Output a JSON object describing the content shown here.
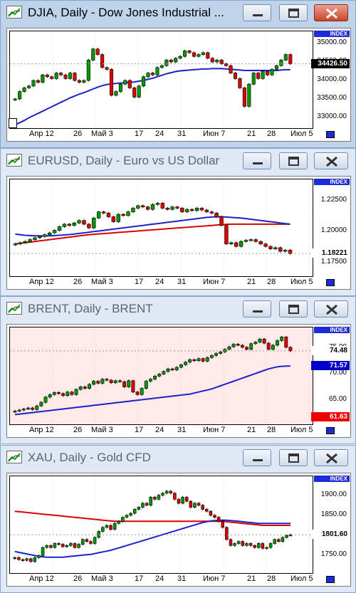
{
  "windows": [
    {
      "title": "DJIA, Daily - Dow Jones Industrial ...",
      "active": true,
      "index_label": "INDEX",
      "background": "#ffffff",
      "y_ticks": [
        "35000.00",
        "34500.00",
        "34000.00",
        "33500.00",
        "33000.00"
      ],
      "price_box": {
        "label": "34426.50",
        "bg": "#000000",
        "fg": "#ffffff"
      },
      "extra_boxes": [],
      "x_labels": [
        "Апр 12",
        "26",
        "Май 3",
        "17",
        "24",
        "31",
        "Июн 7",
        "21",
        "28",
        "Июл 5"
      ]
    },
    {
      "title": "EURUSD, Daily - Euro vs US Dollar",
      "active": false,
      "index_label": "INDEX",
      "background": "#ffffff",
      "y_ticks": [
        "1.22500",
        "1.20000",
        "1.17500"
      ],
      "price_box": {
        "label": "1.18221",
        "bg": "#ffffff",
        "fg": "#000000"
      },
      "extra_boxes": [],
      "x_labels": [
        "Апр 12",
        "26",
        "Май 3",
        "17",
        "24",
        "31",
        "Июн 7",
        "21",
        "28",
        "Июл 5"
      ]
    },
    {
      "title": "BRENT, Daily - BRENT",
      "active": false,
      "index_label": "INDEX",
      "background": "#ffe9e9",
      "y_ticks": [
        "75.00",
        "70.00",
        "65.00"
      ],
      "price_box": {
        "label": "74.48",
        "bg": "#ffffff",
        "fg": "#000000"
      },
      "extra_boxes": [
        {
          "label": "71.57",
          "bg": "#0000cc",
          "fg": "#ffffff"
        },
        {
          "label": "61.63",
          "bg": "#ee0000",
          "fg": "#ffffff"
        }
      ],
      "x_labels": [
        "Апр 12",
        "26",
        "Май 3",
        "17",
        "24",
        "31",
        "Июн 7",
        "21",
        "28",
        "Июл 5"
      ]
    },
    {
      "title": "XAU, Daily - Gold CFD",
      "active": false,
      "index_label": "INDEX",
      "background": "#ffffff",
      "y_ticks": [
        "1900.00",
        "1850.00",
        "1800.00",
        "1750.00"
      ],
      "price_box": {
        "label": "1801.60",
        "bg": "#ffffff",
        "fg": "#000000"
      },
      "extra_boxes": [],
      "x_labels": [
        "Апр 12",
        "26",
        "Май 3",
        "17",
        "24",
        "31",
        "Июн 7",
        "21",
        "28",
        "Июл 5"
      ]
    }
  ],
  "colors": {
    "bull": "#009900",
    "bear": "#dd0000",
    "ma_fast": "#1d22c9",
    "ma_slow": "#dd0000"
  },
  "chart_data": [
    {
      "type": "candlestick",
      "symbol": "DJIA",
      "ylim": [
        32750,
        35250
      ],
      "close": [
        33500,
        33700,
        33800,
        33850,
        34000,
        33950,
        34150,
        34100,
        34050,
        34200,
        34150,
        34050,
        34200,
        34000,
        33950,
        34000,
        34550,
        34850,
        34700,
        34350,
        34300,
        33600,
        33700,
        33900,
        34000,
        33800,
        33550,
        33850,
        34100,
        34200,
        34150,
        34350,
        34400,
        34550,
        34500,
        34600,
        34650,
        34800,
        34750,
        34650,
        34700,
        34750,
        34600,
        34500,
        34550,
        34450,
        34400,
        34200,
        34050,
        33800,
        33300,
        33900,
        34200,
        34050,
        34250,
        34150,
        34300,
        34400,
        34550,
        34700,
        34450
      ],
      "ma_fast": [
        32800,
        32860,
        32920,
        32990,
        33050,
        33110,
        33170,
        33230,
        33290,
        33350,
        33410,
        33470,
        33530,
        33580,
        33630,
        33670,
        33720,
        33770,
        33820,
        33860,
        33890,
        33910,
        33920,
        33930,
        33940,
        33950,
        33960,
        33980,
        34000,
        34030,
        34060,
        34100,
        34140,
        34180,
        34210,
        34240,
        34260,
        34270,
        34280,
        34290,
        34300,
        34310,
        34310,
        34320,
        34320,
        34320,
        34310,
        34300,
        34290,
        34280,
        34270,
        34270,
        34270,
        34270,
        34270,
        34270,
        34270,
        34270,
        34280,
        34290,
        34290
      ],
      "ma_slow": null
    },
    {
      "type": "candlestick",
      "symbol": "EURUSD",
      "ylim": [
        1.165,
        1.24
      ],
      "close": [
        1.19,
        1.191,
        1.192,
        1.1935,
        1.195,
        1.196,
        1.1975,
        1.199,
        1.201,
        1.204,
        1.206,
        1.205,
        1.207,
        1.209,
        1.206,
        1.203,
        1.211,
        1.216,
        1.215,
        1.212,
        1.208,
        1.214,
        1.213,
        1.216,
        1.219,
        1.221,
        1.22,
        1.218,
        1.222,
        1.223,
        1.219,
        1.218,
        1.22,
        1.219,
        1.216,
        1.218,
        1.217,
        1.219,
        1.2175,
        1.216,
        1.215,
        1.212,
        1.205,
        1.19,
        1.191,
        1.188,
        1.192,
        1.193,
        1.1935,
        1.192,
        1.19,
        1.188,
        1.186,
        1.187,
        1.184,
        1.185,
        1.1822
      ],
      "ma_fast": [
        1.198,
        1.1975,
        1.197,
        1.1968,
        1.1966,
        1.1965,
        1.1965,
        1.1966,
        1.1968,
        1.197,
        1.1973,
        1.1976,
        1.198,
        1.1985,
        1.199,
        1.1995,
        1.2,
        1.2005,
        1.201,
        1.2015,
        1.202,
        1.2025,
        1.203,
        1.2035,
        1.204,
        1.2045,
        1.205,
        1.2055,
        1.206,
        1.2065,
        1.207,
        1.2075,
        1.208,
        1.2085,
        1.209,
        1.2095,
        1.21,
        1.2105,
        1.211,
        1.2115,
        1.2118,
        1.212,
        1.212,
        1.2118,
        1.2115,
        1.2112,
        1.211,
        1.2105,
        1.21,
        1.2095,
        1.209,
        1.2085,
        1.208,
        1.2075,
        1.207,
        1.2065,
        1.206
      ],
      "ma_slow": [
        1.19,
        1.1905,
        1.191,
        1.1915,
        1.192,
        1.1925,
        1.193,
        1.1935,
        1.194,
        1.1945,
        1.195,
        1.1955,
        1.196,
        1.1965,
        1.197,
        1.1975,
        1.1978,
        1.1981,
        1.1984,
        1.1987,
        1.199,
        1.1993,
        1.1996,
        1.1999,
        1.2002,
        1.2005,
        1.2008,
        1.2011,
        1.2014,
        1.2017,
        1.202,
        1.2023,
        1.2026,
        1.2029,
        1.2032,
        1.2035,
        1.2038,
        1.2041,
        1.2044,
        1.2047,
        1.205,
        1.2053,
        1.2056,
        1.2059,
        1.206,
        1.206,
        1.206,
        1.206,
        1.206,
        1.206,
        1.206,
        1.206,
        1.206,
        1.206,
        1.206,
        1.206,
        1.206
      ]
    },
    {
      "type": "candlestick",
      "symbol": "BRENT",
      "ylim": [
        60.5,
        78.5
      ],
      "close": [
        62.8,
        63.0,
        63.2,
        63.4,
        63.1,
        63.8,
        64.5,
        65.5,
        66.0,
        66.4,
        66.2,
        65.8,
        66.5,
        66.0,
        67.0,
        67.5,
        67.2,
        68.0,
        68.6,
        68.2,
        69.0,
        68.8,
        68.3,
        68.7,
        68.5,
        67.5,
        68.7,
        66.5,
        66.0,
        67.2,
        68.6,
        69.0,
        69.6,
        70.0,
        70.5,
        71.0,
        70.8,
        71.3,
        71.8,
        72.3,
        72.8,
        72.6,
        73.0,
        72.5,
        73.2,
        73.6,
        74.0,
        74.3,
        74.8,
        75.3,
        75.8,
        75.6,
        75.2,
        74.8,
        75.9,
        76.2,
        76.8,
        76.0,
        74.8,
        75.6,
        76.5,
        77.2,
        75.2,
        74.5
      ],
      "ma_fast": [
        62.1,
        62.2,
        62.3,
        62.4,
        62.5,
        62.6,
        62.7,
        62.8,
        62.9,
        63.0,
        63.1,
        63.2,
        63.3,
        63.4,
        63.5,
        63.6,
        63.7,
        63.8,
        63.9,
        64.0,
        64.1,
        64.2,
        64.3,
        64.4,
        64.5,
        64.6,
        64.7,
        64.8,
        64.9,
        65.0,
        65.1,
        65.2,
        65.3,
        65.4,
        65.5,
        65.6,
        65.7,
        65.8,
        65.9,
        66.0,
        66.1,
        66.3,
        66.5,
        66.7,
        66.9,
        67.1,
        67.4,
        67.7,
        68.0,
        68.3,
        68.6,
        68.9,
        69.2,
        69.5,
        69.8,
        70.1,
        70.4,
        70.7,
        71.0,
        71.2,
        71.4,
        71.5,
        71.55,
        71.57
      ],
      "ma_slow": null
    },
    {
      "type": "candlestick",
      "symbol": "XAU",
      "ylim": [
        1710,
        1940
      ],
      "close": [
        1745,
        1740,
        1738,
        1742,
        1735,
        1745,
        1750,
        1770,
        1775,
        1770,
        1780,
        1778,
        1772,
        1775,
        1780,
        1770,
        1778,
        1790,
        1785,
        1780,
        1795,
        1810,
        1820,
        1825,
        1815,
        1830,
        1835,
        1845,
        1850,
        1855,
        1865,
        1870,
        1880,
        1875,
        1895,
        1890,
        1900,
        1905,
        1910,
        1905,
        1890,
        1880,
        1895,
        1885,
        1870,
        1880,
        1875,
        1865,
        1860,
        1850,
        1845,
        1835,
        1820,
        1790,
        1775,
        1780,
        1785,
        1775,
        1780,
        1775,
        1770,
        1780,
        1768,
        1770,
        1780,
        1790,
        1785,
        1795,
        1800,
        1801.6
      ],
      "ma_fast": [
        1760,
        1758,
        1756,
        1754,
        1752,
        1750,
        1748,
        1747,
        1746,
        1746,
        1746,
        1746,
        1746,
        1747,
        1748,
        1749,
        1750,
        1751,
        1752,
        1753,
        1755,
        1757,
        1759,
        1761,
        1763,
        1766,
        1769,
        1772,
        1775,
        1778,
        1781,
        1784,
        1787,
        1790,
        1793,
        1796,
        1799,
        1802,
        1805,
        1808,
        1811,
        1814,
        1817,
        1820,
        1823,
        1826,
        1829,
        1832,
        1834,
        1836,
        1837,
        1838,
        1838,
        1838,
        1837,
        1836,
        1835,
        1834,
        1833,
        1832,
        1831,
        1830,
        1830,
        1830,
        1830,
        1830,
        1830,
        1830,
        1830,
        1830
      ],
      "ma_slow": [
        1860,
        1859,
        1858,
        1857,
        1856,
        1855,
        1854,
        1853,
        1852,
        1851,
        1850,
        1849,
        1848,
        1847,
        1846,
        1845,
        1844,
        1843,
        1842,
        1841,
        1840,
        1839,
        1838,
        1837,
        1836,
        1835,
        1835,
        1835,
        1835,
        1835,
        1835,
        1835,
        1835,
        1835,
        1835,
        1835,
        1835,
        1835,
        1835,
        1835,
        1835,
        1835,
        1835,
        1835,
        1835,
        1835,
        1835,
        1835,
        1835,
        1835,
        1835,
        1835,
        1835,
        1834,
        1833,
        1832,
        1831,
        1830,
        1829,
        1828,
        1827,
        1826,
        1825,
        1825,
        1825,
        1825,
        1825,
        1825,
        1825,
        1825
      ]
    }
  ]
}
